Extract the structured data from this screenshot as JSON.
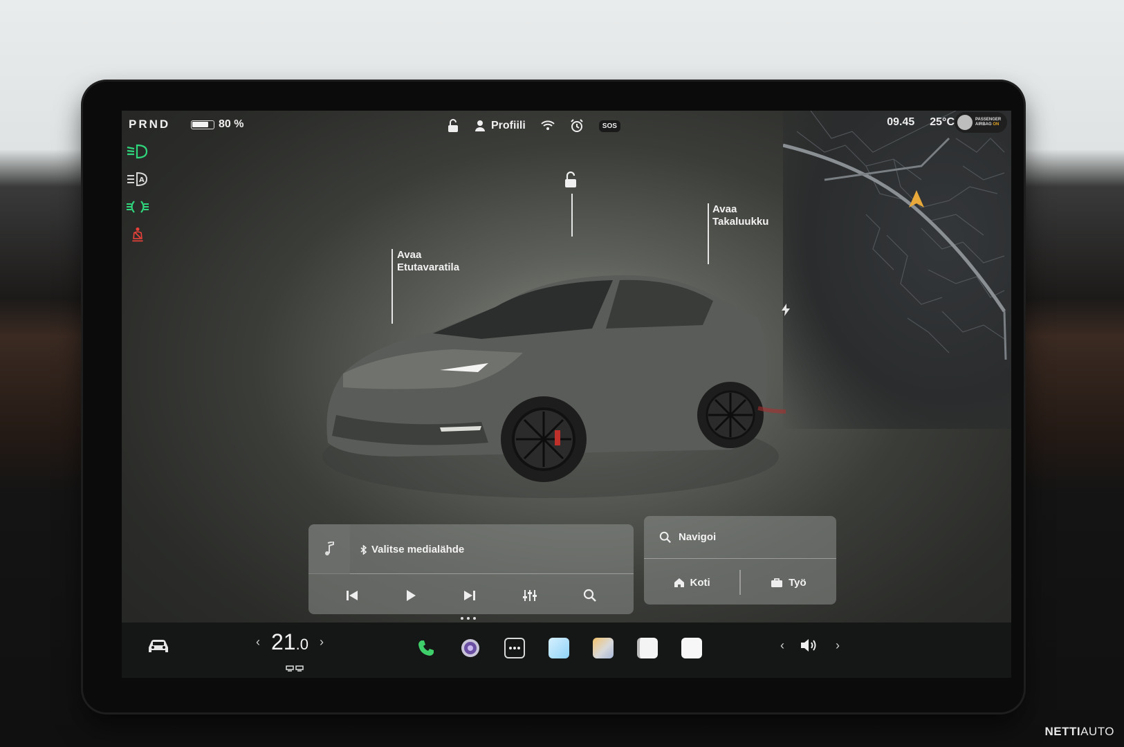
{
  "status_bar": {
    "gear": "PRND",
    "battery_percent": "80 %",
    "battery_level": 0.8,
    "profile_label": "Profiili",
    "sos_label": "SOS",
    "time": "09.45",
    "outside_temp": "25°C",
    "airbag_label_line1": "PASSENGER",
    "airbag_label_line2": "AIRBAG",
    "airbag_status": "ON"
  },
  "indicators": [
    {
      "icon": "low-beam-icon",
      "color": "#2fd67b"
    },
    {
      "icon": "auto-high-beam-icon",
      "color": "#d8d8d8"
    },
    {
      "icon": "parking-lights-icon",
      "color": "#2fd67b"
    },
    {
      "icon": "seatbelt-warning-icon",
      "color": "#e8413a"
    }
  ],
  "car_view": {
    "frunk_label_line1": "Avaa",
    "frunk_label_line2": "Etutavaratila",
    "trunk_label_line1": "Avaa",
    "trunk_label_line2": "Takaluukku",
    "lock_icon": "unlock-icon",
    "charge_icon": "charge-port-icon"
  },
  "media": {
    "source_label": "Valitse medialähde",
    "icons": [
      "music-note-icon",
      "bluetooth-icon",
      "previous-icon",
      "play-icon",
      "next-icon",
      "equalizer-icon",
      "search-icon"
    ]
  },
  "navigation": {
    "search_label": "Navigoi",
    "home_label": "Koti",
    "work_label": "Työ"
  },
  "dock": {
    "temperature": "21",
    "temperature_decimal": ".0",
    "apps": [
      "phone-icon",
      "camera-icon",
      "more-icon",
      "app-square-icon",
      "photo-app-icon",
      "notes-icon",
      "app-white-icon"
    ]
  },
  "watermark": {
    "part1": "NETTI",
    "part2": "AUTO"
  },
  "colors": {
    "accent_green": "#2fd67b",
    "warning_red": "#e8413a",
    "airbag_on": "#e6a623"
  }
}
